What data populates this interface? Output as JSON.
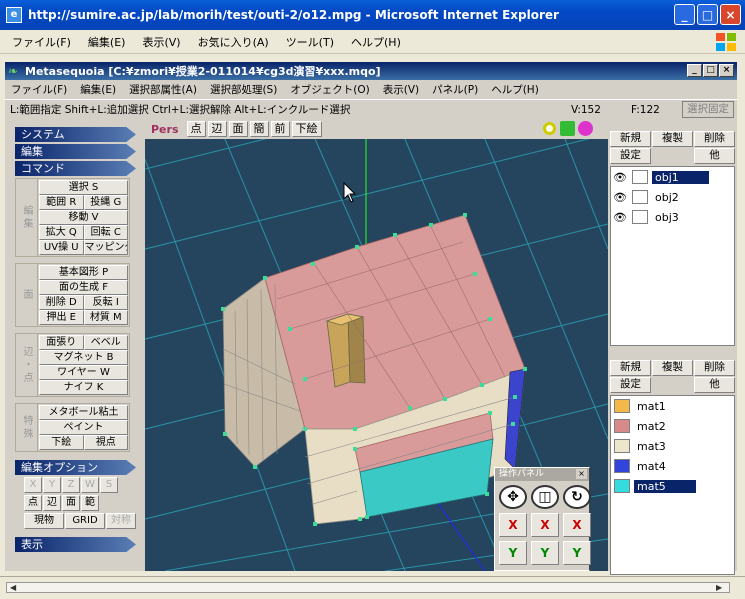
{
  "ie": {
    "title": "http://sumire.ac.jp/lab/morih/test/outi-2/o12.mpg - Microsoft Internet Explorer",
    "menu": [
      "ファイル(F)",
      "編集(E)",
      "表示(V)",
      "お気に入り(A)",
      "ツール(T)",
      "ヘルプ(H)"
    ]
  },
  "app": {
    "title": "Metasequoia [C:¥zmori¥授業2-011014¥cg3d演習¥xxx.mqo]",
    "menu": [
      "ファイル(F)",
      "編集(E)",
      "選択部属性(A)",
      "選択部処理(S)",
      "オブジェクト(O)",
      "表示(V)",
      "パネル(P)",
      "ヘルプ(H)"
    ],
    "status_hint": "L:範囲指定 Shift+L:追加選択 Ctrl+L:選択解除 Alt+L:インクルード選択",
    "vertex_count": "V:152",
    "face_count": "F:122",
    "fix_selection": "選択固定"
  },
  "left": {
    "system": "システム",
    "edit": "編集",
    "command": "コマンド",
    "edit_group_label": "編集",
    "face_group_label": "面",
    "edge_group_label": "辺・点",
    "special_group_label": "特殊",
    "select": "選択 S",
    "range": "範囲 R",
    "lasso": "投縄 G",
    "move": "移動 V",
    "scale": "拡大 Q",
    "rotate": "回転 C",
    "uv": "UV操 U",
    "mapping": "マッピング",
    "basic_shape": "基本図形 P",
    "face_gen": "面の生成 F",
    "delete": "削除 D",
    "invert": "反転 I",
    "extrude": "押出 E",
    "material": "材質 M",
    "face_cut": "面張り",
    "bevel": "ベベル",
    "magnet": "マグネット B",
    "wire": "ワイヤー W",
    "knife": "ナイフ K",
    "metaball": "メタボール粘土",
    "paint": "ペイント",
    "underlay": "下絵",
    "viewpoint": "視点",
    "edit_options": "編集オプション",
    "opt_x": "X",
    "opt_y": "Y",
    "opt_z": "Z",
    "opt_w": "W",
    "opt_s": "S",
    "opt_point": "点",
    "opt_edge": "辺",
    "opt_face": "面",
    "opt_range": "範",
    "opt_current": "現物",
    "opt_grid": "GRID",
    "opt_sym": "対称",
    "display": "表示"
  },
  "viewport": {
    "mode": "Pers",
    "buttons": [
      "点",
      "辺",
      "面",
      "簡",
      "前",
      "下絵"
    ]
  },
  "objects_panel": {
    "new": "新規",
    "copy": "複製",
    "delete": "削除",
    "settings": "設定",
    "other": "他",
    "items": [
      "obj1",
      "obj2",
      "obj3"
    ]
  },
  "materials_panel": {
    "new": "新規",
    "copy": "複製",
    "delete": "削除",
    "settings": "設定",
    "other": "他",
    "items": [
      "mat1",
      "mat2",
      "mat3",
      "mat4",
      "mat5"
    ],
    "colors": [
      "#f4b84a",
      "#d88a8a",
      "#ece6cc",
      "#3344dd",
      "#33dddd"
    ]
  },
  "ops_panel": {
    "title": "操作パネル",
    "x": "X",
    "y": "Y"
  }
}
